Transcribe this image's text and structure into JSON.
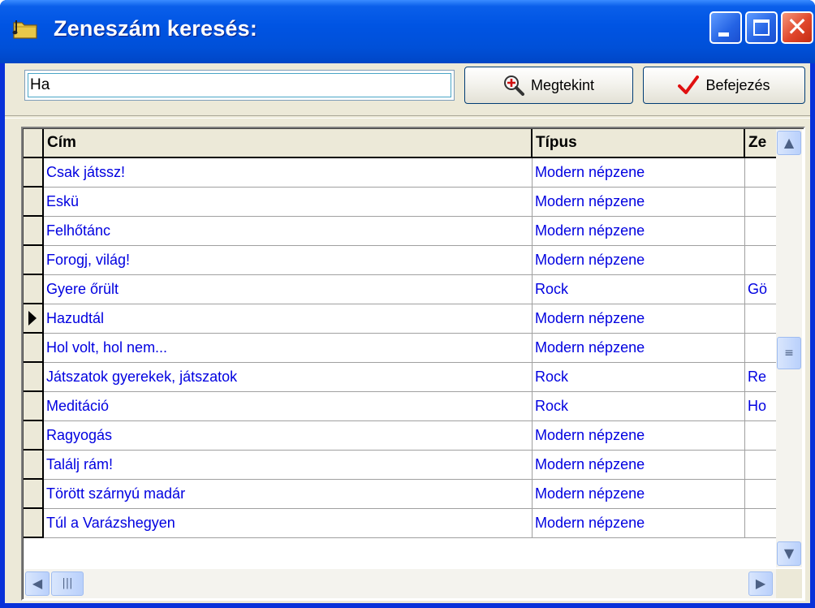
{
  "window": {
    "title": "Zeneszám keresés:"
  },
  "search": {
    "value": "Ha"
  },
  "buttons": {
    "view_label": "Megtekint",
    "finish_label": "Befejezés"
  },
  "grid": {
    "columns": [
      "Cím",
      "Típus",
      "Ze"
    ],
    "current_row_index": 5,
    "rows": [
      [
        "Csak játssz!",
        "Modern népzene",
        ""
      ],
      [
        "Eskü",
        "Modern népzene",
        ""
      ],
      [
        "Felhőtánc",
        "Modern népzene",
        ""
      ],
      [
        "Forogj, világ!",
        "Modern népzene",
        ""
      ],
      [
        "Gyere őrült",
        "Rock",
        "Gö"
      ],
      [
        "Hazudtál",
        "Modern népzene",
        ""
      ],
      [
        "Hol volt, hol nem...",
        "Modern népzene",
        ""
      ],
      [
        "Játszatok gyerekek, játszatok",
        "Rock",
        "Re"
      ],
      [
        "Meditáció",
        "Rock",
        "Ho"
      ],
      [
        "Ragyogás",
        "Modern népzene",
        ""
      ],
      [
        "Találj rám!",
        "Modern népzene",
        ""
      ],
      [
        "Törött szárnyú madár",
        "Modern népzene",
        ""
      ],
      [
        "Túl a Varázshegyen",
        "Modern népzene",
        ""
      ]
    ]
  },
  "colors": {
    "title_bar": "#0054e3",
    "cell_text": "#0000e0",
    "dialog_bg": "#ece9d8"
  },
  "icons": [
    "folder-note-icon",
    "minimize-icon",
    "maximize-icon",
    "close-icon",
    "zoom-in-icon",
    "checkmark-icon",
    "row-pointer-icon",
    "scroll-up-icon",
    "scroll-down-icon",
    "scroll-left-icon",
    "scroll-right-icon"
  ]
}
